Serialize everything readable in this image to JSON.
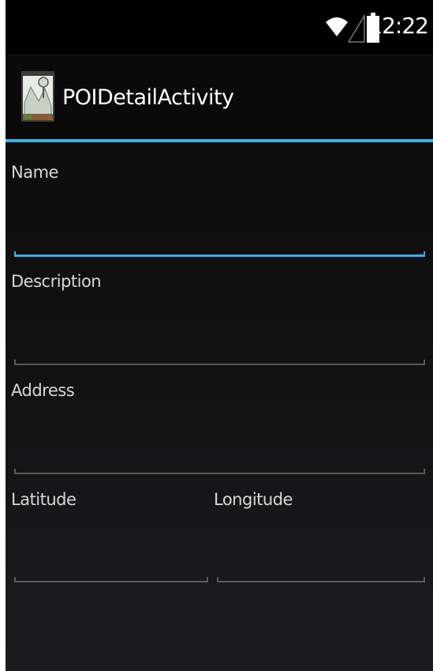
{
  "status_bar": {
    "time": "12:22",
    "icons": [
      "wifi-icon",
      "cell-signal-icon",
      "battery-icon"
    ]
  },
  "action_bar": {
    "title": "POIDetailActivity",
    "app_icon": "map-pin-app-icon"
  },
  "form": {
    "name_label": "Name",
    "name_value": "",
    "description_label": "Description",
    "description_value": "",
    "address_label": "Address",
    "address_value": "",
    "latitude_label": "Latitude",
    "latitude_value": "",
    "longitude_label": "Longitude",
    "longitude_value": ""
  },
  "colors": {
    "accent": "#33b5e5",
    "background": "#101010",
    "text": "#d8d8d8",
    "underline": "#5a5a5a"
  }
}
